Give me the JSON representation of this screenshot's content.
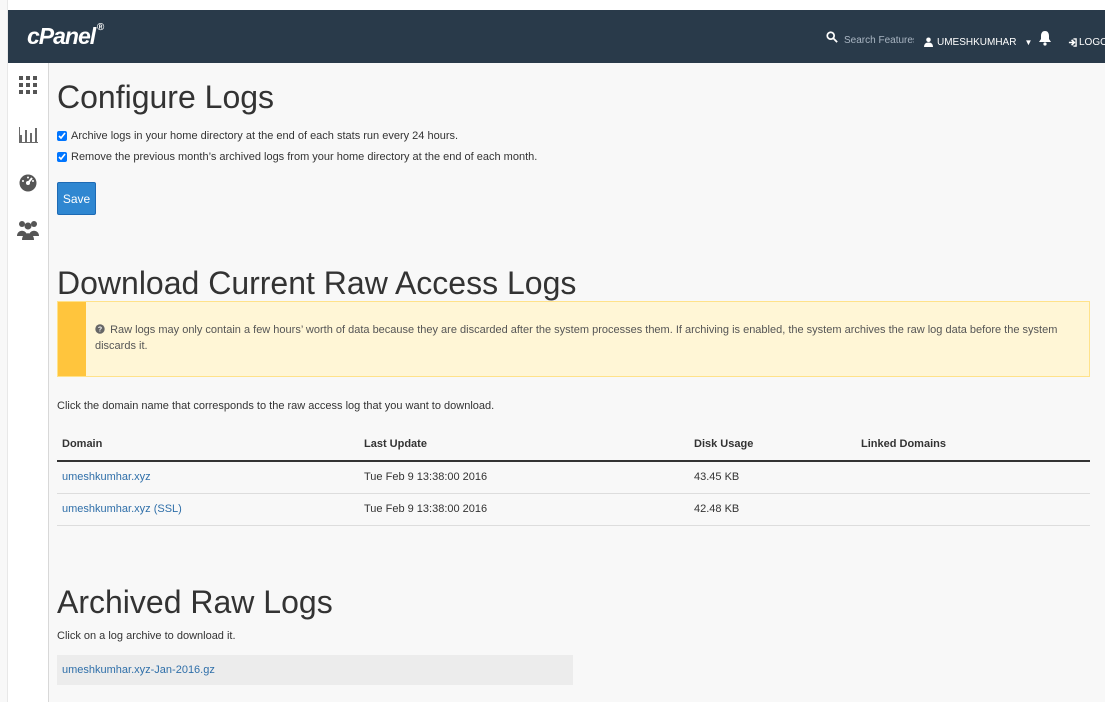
{
  "brand": {
    "name": "cPanel",
    "mark": "®"
  },
  "topbar": {
    "search_placeholder": "Search Features",
    "username": "UMESHKUMHAR",
    "logout": "LOGOUT"
  },
  "sidebar": {
    "items": [
      "home-grid-icon",
      "statistics-icon",
      "dashboard-icon",
      "users-icon"
    ]
  },
  "configure": {
    "title": "Configure Logs",
    "options": [
      "Archive logs in your home directory at the end of each stats run every 24 hours.",
      "Remove the previous month’s archived logs from your home directory at the end of each month."
    ],
    "save_label": "Save"
  },
  "raw_logs": {
    "title": "Download Current Raw Access Logs",
    "notice": "Raw logs may only contain a few hours’ worth of data because they are discarded after the system processes them. If archiving is enabled, the system archives the raw log data before the system discards it.",
    "instruction": "Click the domain name that corresponds to the raw access log that you want to download.",
    "columns": [
      "Domain",
      "Last Update",
      "Disk Usage",
      "Linked Domains"
    ],
    "rows": [
      {
        "domain": "umeshkumhar.xyz",
        "last_update": "Tue Feb 9 13:38:00 2016",
        "disk_usage": "43.45 KB",
        "linked": ""
      },
      {
        "domain": "umeshkumhar.xyz (SSL)",
        "last_update": "Tue Feb 9 13:38:00 2016",
        "disk_usage": "42.48 KB",
        "linked": ""
      }
    ]
  },
  "archived": {
    "title": "Archived Raw Logs",
    "description": "Click on a log archive to download it.",
    "items": [
      "umeshkumhar.xyz-Jan-2016.gz"
    ]
  },
  "colors": {
    "topbar": "#293a4a",
    "accent": "#2f87d1",
    "link": "#2f6fa9",
    "alert": "#ffc53d"
  }
}
